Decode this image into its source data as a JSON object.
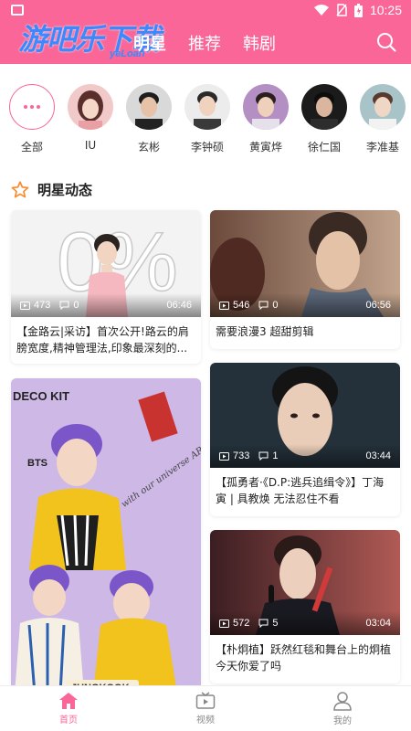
{
  "status_bar": {
    "time": "10:25"
  },
  "watermark": {
    "title": "游吧乐下载",
    "sub": "yeLoan"
  },
  "header": {
    "tabs": [
      {
        "label": "明星",
        "active": true
      },
      {
        "label": "推荐",
        "active": false
      },
      {
        "label": "韩剧",
        "active": false
      }
    ],
    "search_icon": "search-icon"
  },
  "stars": [
    {
      "name": "全部",
      "avatar": "more-dots-icon"
    },
    {
      "name": "IU"
    },
    {
      "name": "玄彬"
    },
    {
      "name": "李钟硕"
    },
    {
      "name": "黄寅烨"
    },
    {
      "name": "徐仁国"
    },
    {
      "name": "李准基"
    }
  ],
  "section": {
    "title": "明星动态",
    "icon": "star-outline-icon"
  },
  "cards": [
    {
      "plays": "473",
      "comments": "0",
      "duration": "06:46",
      "title": "【金路云|采访】首次公开!路云的肩膀宽度,精神管理法,印象最深刻的..."
    },
    {
      "plays": "546",
      "comments": "0",
      "duration": "06:56",
      "title": "需要浪漫3 超甜剪辑"
    },
    {
      "plays": "",
      "comments": "",
      "duration": "",
      "title": "",
      "thumb_text": [
        "DECO KIT",
        "BTS",
        "with our universe ARMY",
        "JUNGKOOK"
      ]
    },
    {
      "plays": "733",
      "comments": "1",
      "duration": "03:44",
      "title": "【孤勇者·《D.P:逃兵追缉令》】丁海寅 | 具教焕 无法忍住不看"
    },
    {
      "plays": "572",
      "comments": "5",
      "duration": "03:04",
      "title": "【朴炯植】跃然红毯和舞台上的炯植 今天你爱了吗"
    }
  ],
  "thumb_text_big": "0%",
  "bottom_nav": [
    {
      "label": "首页",
      "icon": "home-icon",
      "active": true
    },
    {
      "label": "视频",
      "icon": "video-icon",
      "active": false
    },
    {
      "label": "我的",
      "icon": "profile-icon",
      "active": false
    }
  ],
  "colors": {
    "accent": "#f96697",
    "watermark": "#3b89ff"
  }
}
